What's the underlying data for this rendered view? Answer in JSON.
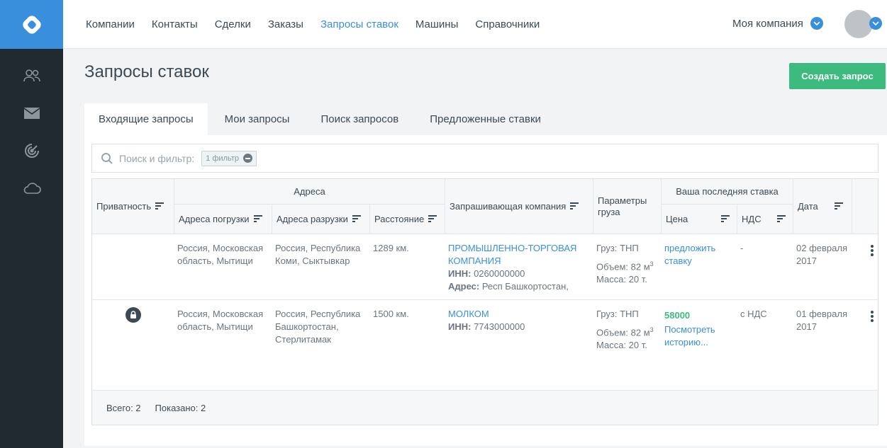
{
  "nav": {
    "items": [
      "Компании",
      "Контакты",
      "Сделки",
      "Заказы",
      "Запросы ставок",
      "Машины",
      "Справочники"
    ],
    "active_index": 4,
    "company": "Моя компания"
  },
  "sidebar": {
    "icons": [
      "contacts-icon",
      "mail-icon",
      "target-icon",
      "cloud-icon"
    ]
  },
  "page": {
    "title": "Запросы ставок",
    "create_button": "Создать запрос"
  },
  "tabs": [
    "Входящие запросы",
    "Мои запросы",
    "Поиск запросов",
    "Предложенные ставки"
  ],
  "active_tab": 0,
  "search": {
    "placeholder": "Поиск и фильтр:",
    "filter_chip": "1 фильтр"
  },
  "table": {
    "headers": {
      "privacy": "Приватность",
      "addresses": "Адреса",
      "load": "Адреса погрузки",
      "unload": "Адреса разрузки",
      "distance": "Расстояние",
      "company": "Запрашивающая компания",
      "cargo": "Параметры груза",
      "last_bid": "Ваша последняя ставка",
      "price": "Цена",
      "vat": "НДС",
      "date": "Дата"
    },
    "rows": [
      {
        "private": false,
        "load": "Россия, Московская область, Мытищи",
        "unload": "Россия, Республика Коми, Сыктывкар",
        "distance": "1289 км.",
        "company_name": "ПРОМЫШЛЕННО-ТОРГОВАЯ КОМПАНИЯ",
        "inn_label": "ИНН:",
        "inn": "0260000000",
        "address_label": "Адрес:",
        "address": "Респ Башкортостан,",
        "cargo_type": "Груз: ТНП",
        "volume": "Объем: 82 м",
        "volume_sup": "3",
        "mass": "Масса: 20 т.",
        "price": "предложить ставку",
        "price_value": "",
        "vat": "-",
        "date": "02 февраля 2017"
      },
      {
        "private": true,
        "load": "Россия, Московская область, Мытищи",
        "unload": "Россия, Республика Башкортостан, Стерлитамак",
        "distance": "1500 км.",
        "company_name": "МОЛКОМ",
        "inn_label": "ИНН:",
        "inn": "7743000000",
        "cargo_type": "Груз: ТНП",
        "volume": "Объем: 82 м",
        "volume_sup": "3",
        "mass": "Масса: 20 т.",
        "price_value": "58000",
        "price": "Посмотреть историю...",
        "vat": "с НДС",
        "date": "01 февраля 2017"
      }
    ]
  },
  "footer": {
    "total": "Всего: 2",
    "shown": "Показано: 2"
  }
}
